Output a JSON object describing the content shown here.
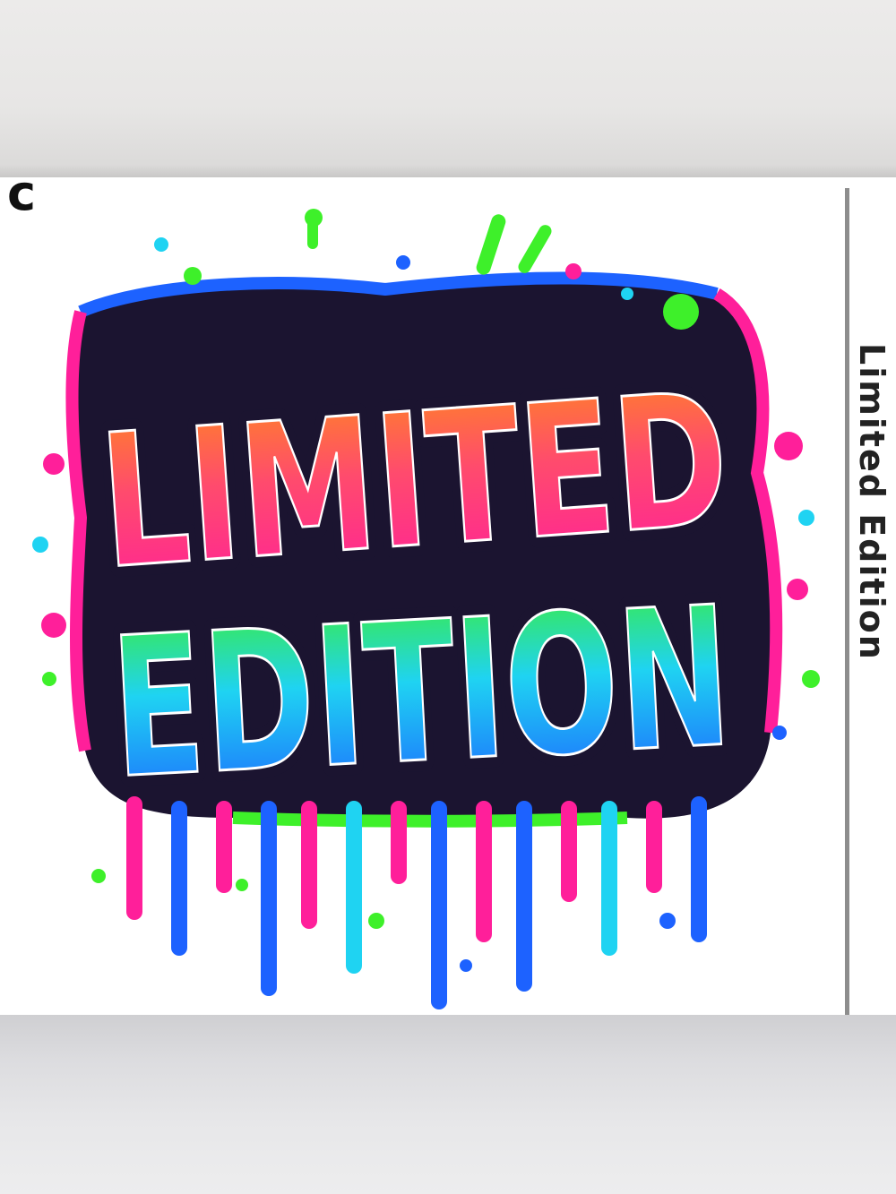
{
  "artwork": {
    "line1": "LIMITED",
    "line2": "EDITION",
    "colors": {
      "pink": "#ff1f9a",
      "orange": "#ff8a1e",
      "green": "#3ef02a",
      "cyan": "#1fd3f2",
      "blue": "#1d62ff",
      "outline": "#1b1430"
    }
  },
  "side_text": "Limited Edition",
  "corner_glyph": "c"
}
